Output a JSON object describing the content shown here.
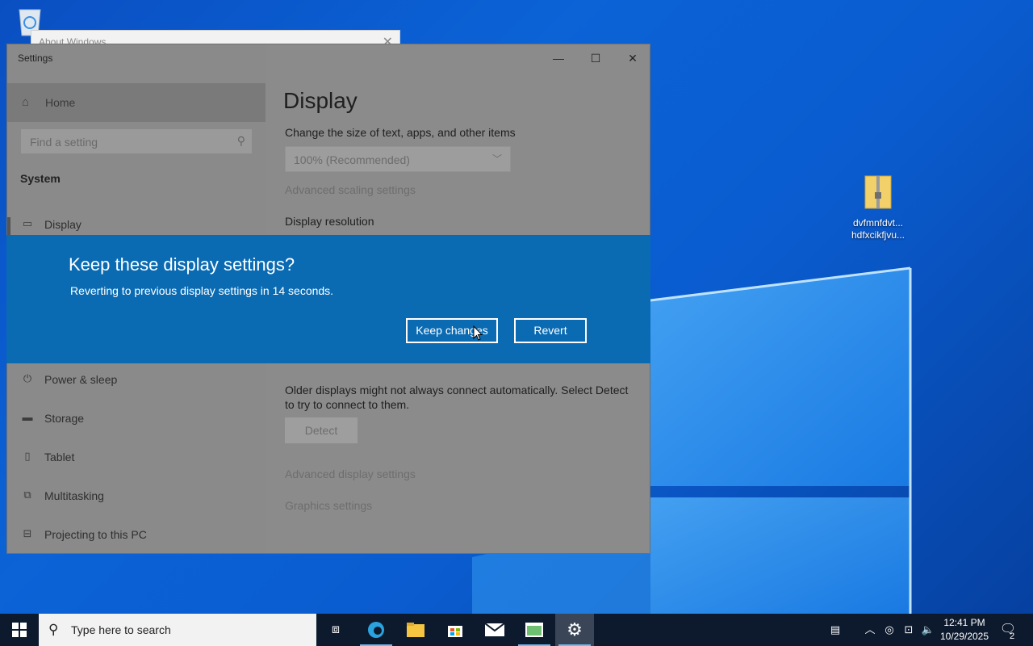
{
  "desktop": {
    "recycle_bin_label": "",
    "zip_file_label_line1": "dvfmnfdvt...",
    "zip_file_label_line2": "hdfxcikfjvu..."
  },
  "about_window": {
    "title": "About Windows"
  },
  "settings": {
    "title": "Settings",
    "window_controls": {
      "minimize": "—",
      "maximize": "☐",
      "close": "✕"
    },
    "sidebar": {
      "home_label": "Home",
      "search_placeholder": "Find a setting",
      "section_header": "System",
      "items": [
        {
          "label": "Display",
          "icon": "monitor-icon",
          "glyph": "▭"
        },
        {
          "label": "Power & sleep",
          "icon": "power-icon",
          "glyph": "⏻"
        },
        {
          "label": "Storage",
          "icon": "storage-icon",
          "glyph": "▬"
        },
        {
          "label": "Tablet",
          "icon": "tablet-icon",
          "glyph": "▯"
        },
        {
          "label": "Multitasking",
          "icon": "multitasking-icon",
          "glyph": "⧉"
        },
        {
          "label": "Projecting to this PC",
          "icon": "projecting-icon",
          "glyph": "⊟"
        }
      ]
    },
    "main": {
      "page_title": "Display",
      "scale_label": "Change the size of text, apps, and other items",
      "scale_value": "100% (Recommended)",
      "advanced_scaling_link": "Advanced scaling settings",
      "resolution_label": "Display resolution",
      "detect_text_line1": "Older displays might not always connect automatically. Select Detect",
      "detect_text_line2": "to try to connect to them.",
      "detect_button": "Detect",
      "advanced_display_link": "Advanced display settings",
      "graphics_link": "Graphics settings"
    }
  },
  "dialog": {
    "title": "Keep these display settings?",
    "message": "Reverting to previous display settings in 14 seconds.",
    "keep_button": "Keep changes",
    "revert_button": "Revert"
  },
  "taskbar": {
    "search_placeholder": "Type here to search",
    "time": "12:41 PM",
    "date": "10/29/2025",
    "notification_count": "2"
  },
  "colors": {
    "dialog_bg": "#0a6bb3",
    "taskbar_bg": "#0d1a2e",
    "desktop_blue": "#0b63d6"
  }
}
